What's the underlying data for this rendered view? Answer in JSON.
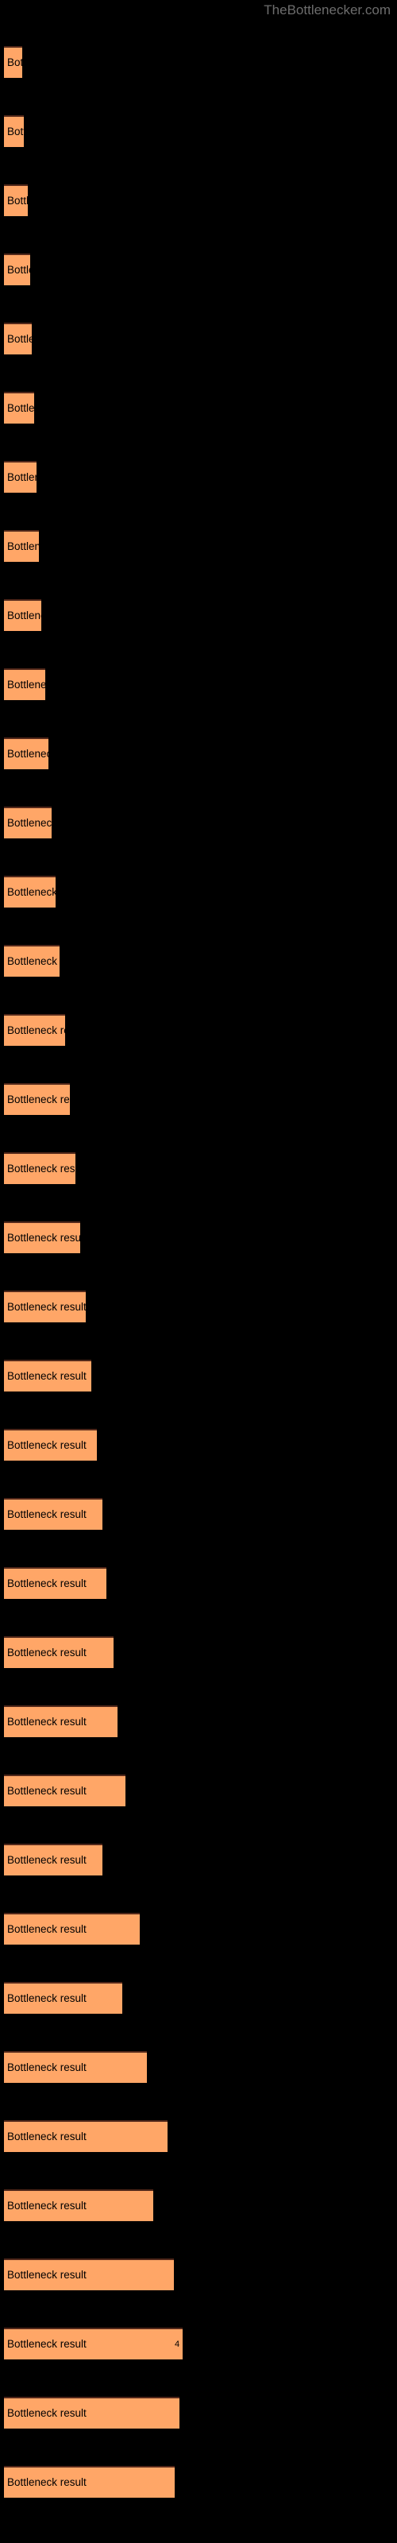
{
  "site": {
    "watermark": "TheBottlenecker.com"
  },
  "chart_data": {
    "type": "bar",
    "orientation": "horizontal",
    "title": "",
    "subtitle": "",
    "xlabel": "",
    "ylabel": "",
    "grid": false,
    "legend": null,
    "background_color": "#000000",
    "bar_color": "#ffa667",
    "bar_edge_color": "#52281a",
    "label_color": "#000000",
    "watermark_color": "#6d6d6d",
    "bar_label_text": "Bottleneck result",
    "xlim": [
      0,
      240
    ],
    "categories": [
      "Bottleneck result",
      "Bottleneck result",
      "Bottleneck result",
      "Bottleneck result",
      "Bottleneck result",
      "Bottleneck result",
      "Bottleneck result",
      "Bottleneck result",
      "Bottleneck result",
      "Bottleneck result",
      "Bottleneck result",
      "Bottleneck result",
      "Bottleneck result",
      "Bottleneck result",
      "Bottleneck result",
      "Bottleneck result",
      "Bottleneck result",
      "Bottleneck result",
      "Bottleneck result",
      "Bottleneck result",
      "Bottleneck result",
      "Bottleneck result",
      "Bottleneck result",
      "Bottleneck result",
      "Bottleneck result",
      "Bottleneck result",
      "Bottleneck result",
      "Bottleneck result",
      "Bottleneck result",
      "Bottleneck result",
      "Bottleneck result",
      "Bottleneck result",
      "Bottleneck result",
      "Bottleneck result",
      "Bottleneck result",
      "Bottleneck result"
    ],
    "values": [
      23,
      25,
      30,
      33,
      35,
      38,
      41,
      44,
      47,
      52,
      56,
      60,
      65,
      70,
      77,
      83,
      90,
      96,
      103,
      110,
      117,
      124,
      129,
      138,
      143,
      153,
      124,
      171,
      149,
      180,
      206,
      188,
      214,
      225,
      221,
      215
    ],
    "bar_tops": [
      58,
      145,
      232,
      319,
      406,
      493,
      580,
      667,
      754,
      841,
      928,
      1015,
      1102,
      1189,
      1276,
      1363,
      1450,
      1537,
      1624,
      1711,
      1798,
      1885,
      1972,
      2059,
      2146,
      2233,
      2320,
      2407,
      2494,
      2581,
      2668,
      2755,
      2842,
      2929,
      3016,
      3103
    ],
    "value_labels": [
      "",
      "",
      "",
      "",
      "",
      "",
      "",
      "",
      "",
      "",
      "",
      "",
      "",
      "",
      "",
      "",
      "",
      "",
      "",
      "",
      "",
      "",
      "",
      "",
      "",
      "",
      "",
      "",
      "",
      "",
      "",
      "",
      "",
      "4",
      "",
      ""
    ]
  }
}
